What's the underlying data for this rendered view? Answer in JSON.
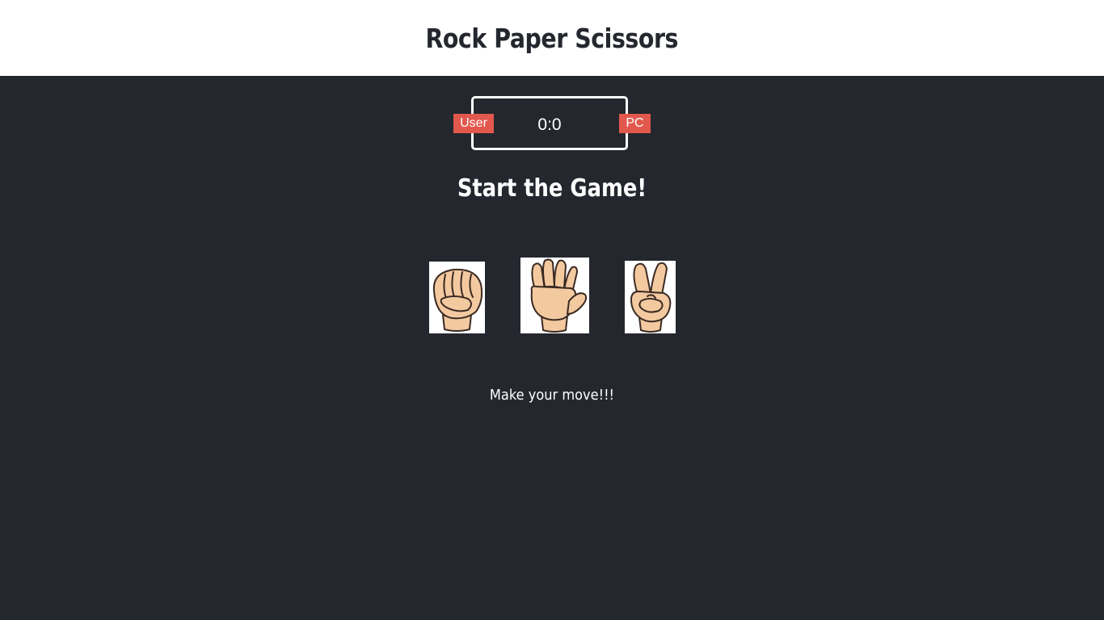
{
  "header": {
    "title": "Rock Paper Scissors"
  },
  "scoreboard": {
    "user_label": "User",
    "pc_label": "PC",
    "user_score": 0,
    "pc_score": 0,
    "score_text": "0:0"
  },
  "status": {
    "result_text": "Start the Game!"
  },
  "choices": [
    {
      "name": "rock",
      "icon": "rock-fist-icon"
    },
    {
      "name": "paper",
      "icon": "paper-open-hand-icon"
    },
    {
      "name": "scissors",
      "icon": "scissors-v-hand-icon"
    }
  ],
  "action_message": "Make your move!!!",
  "colors": {
    "background": "#24272e",
    "header_background": "#ffffff",
    "badge": "#e2584d",
    "skin": "#f3c9a0",
    "outline": "#3a2a22"
  }
}
